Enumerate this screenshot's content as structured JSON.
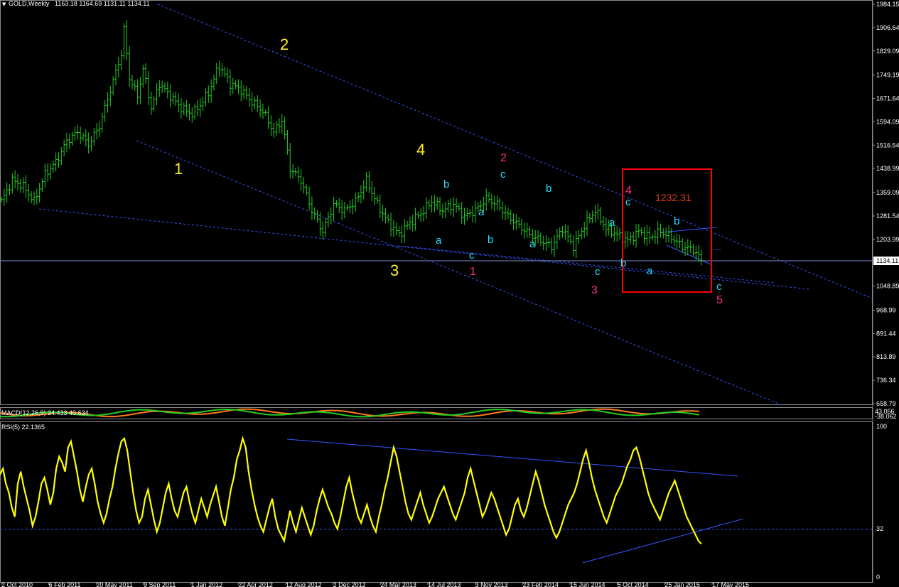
{
  "header": {
    "symbol": "GOLD,Weekly",
    "ohlc": "1163.18 1164.69 1131.11 1134.11",
    "macd_label": "MACD(12,26,9) 24.433 40.634",
    "macd_right_top": "43.056",
    "macd_right_bottom": "-38.062",
    "rsi_label": "RSI(5) 22.1365"
  },
  "price_panel": {
    "current_price_label": "1134.11",
    "box_label": "1232.31"
  },
  "colors": {
    "background": "#000000",
    "bars": "#22cc22",
    "trendlines": "#3355ff",
    "box": "#ff0000",
    "rsi": "#ffff00",
    "wave_yellow": "#ffee22",
    "wave_cyan": "#22e0ff",
    "wave_pink": "#ff2d8a",
    "box_label": "#e03c1e",
    "macd_orange": "#ff7a1a",
    "macd_green": "#22cc22"
  },
  "wave_labels": {
    "yellow": [
      "1",
      "2",
      "3",
      "4"
    ],
    "pink": [
      "1",
      "2",
      "3",
      "4",
      "5"
    ],
    "cyan": [
      "a",
      "b",
      "c",
      "a",
      "b",
      "c",
      "a",
      "b",
      "c",
      "a",
      "b",
      "c",
      "a",
      "b",
      "c"
    ]
  },
  "chart_data": [
    {
      "type": "bar",
      "subtype": "ohlc",
      "title": "GOLD,Weekly",
      "ylim": [
        658.79,
        1984.15
      ],
      "y_ticks": [
        1984.15,
        1906.64,
        1829.09,
        1749.19,
        1671.64,
        1594.09,
        1516.54,
        1438.99,
        1359.09,
        1281.54,
        1203.99,
        1134.11,
        1048.89,
        968.99,
        891.44,
        813.89,
        736.34,
        658.79
      ],
      "x_ticks": [
        "2 Oct 2010",
        "6 Feb 2011",
        "20 May 2011",
        "9 Sep 2011",
        "1 Jan 2012",
        "22 Apr 2012",
        "12 Aug 2012",
        "2 Dec 2012",
        "24 Mar 2013",
        "14 Jul 2013",
        "3 Nov 2013",
        "23 Feb 2014",
        "15 Jun 2014",
        "5 Oct 2014",
        "25 Jan 2015",
        "17 May 2015"
      ],
      "close_path": [
        [
          0,
          1330
        ],
        [
          4,
          1400
        ],
        [
          8,
          1380
        ],
        [
          12,
          1330
        ],
        [
          16,
          1420
        ],
        [
          20,
          1460
        ],
        [
          24,
          1530
        ],
        [
          28,
          1560
        ],
        [
          32,
          1520
        ],
        [
          36,
          1580
        ],
        [
          40,
          1700
        ],
        [
          44,
          1820
        ],
        [
          45,
          1900
        ],
        [
          47,
          1740
        ],
        [
          50,
          1680
        ],
        [
          52,
          1770
        ],
        [
          55,
          1640
        ],
        [
          58,
          1720
        ],
        [
          62,
          1680
        ],
        [
          66,
          1640
        ],
        [
          70,
          1620
        ],
        [
          73,
          1650
        ],
        [
          76,
          1690
        ],
        [
          79,
          1760
        ],
        [
          80,
          1780
        ],
        [
          84,
          1720
        ],
        [
          88,
          1700
        ],
        [
          92,
          1660
        ],
        [
          96,
          1630
        ],
        [
          100,
          1560
        ],
        [
          103,
          1600
        ],
        [
          106,
          1440
        ],
        [
          110,
          1400
        ],
        [
          114,
          1300
        ],
        [
          118,
          1230
        ],
        [
          122,
          1320
        ],
        [
          126,
          1300
        ],
        [
          130,
          1330
        ],
        [
          134,
          1400
        ],
        [
          138,
          1320
        ],
        [
          142,
          1260
        ],
        [
          146,
          1220
        ],
        [
          150,
          1260
        ],
        [
          154,
          1290
        ],
        [
          158,
          1330
        ],
        [
          162,
          1300
        ],
        [
          166,
          1320
        ],
        [
          170,
          1280
        ],
        [
          174,
          1300
        ],
        [
          178,
          1340
        ],
        [
          182,
          1320
        ],
        [
          186,
          1280
        ],
        [
          190,
          1250
        ],
        [
          194,
          1220
        ],
        [
          198,
          1200
        ],
        [
          202,
          1180
        ],
        [
          206,
          1240
        ],
        [
          210,
          1180
        ],
        [
          214,
          1250
        ],
        [
          218,
          1300
        ],
        [
          222,
          1240
        ],
        [
          226,
          1220
        ],
        [
          230,
          1200
        ],
        [
          234,
          1230
        ],
        [
          238,
          1210
        ],
        [
          242,
          1230
        ],
        [
          246,
          1210
        ],
        [
          250,
          1180
        ],
        [
          254,
          1170
        ],
        [
          257,
          1134.11
        ]
      ]
    },
    {
      "type": "line",
      "title": "MACD(12,26,9) 24.433 40.634",
      "series": [
        {
          "name": "MACD",
          "color": "#ff7a1a"
        },
        {
          "name": "Signal",
          "color": "#22cc22"
        }
      ]
    },
    {
      "type": "line",
      "title": "RSI(5) 22.1365",
      "ylim": [
        0,
        100
      ],
      "y_ticks": [
        100,
        32,
        0
      ],
      "levels": [
        32
      ],
      "series": [
        {
          "name": "RSI(5)",
          "values": [
            68,
            72,
            62,
            56,
            46,
            40,
            62,
            70,
            60,
            52,
            44,
            34,
            40,
            50,
            62,
            66,
            58,
            48,
            56,
            72,
            80,
            76,
            70,
            86,
            90,
            80,
            70,
            58,
            50,
            60,
            68,
            72,
            62,
            50,
            42,
            36,
            42,
            52,
            60,
            72,
            82,
            90,
            92,
            84,
            70,
            56,
            44,
            36,
            40,
            52,
            58,
            48,
            38,
            30,
            36,
            46,
            56,
            62,
            52,
            44,
            40,
            48,
            56,
            60,
            50,
            42,
            36,
            44,
            52,
            46,
            40,
            48,
            54,
            60,
            50,
            40,
            34,
            46,
            58,
            66,
            78,
            84,
            92,
            86,
            70,
            58,
            48,
            40,
            34,
            30,
            38,
            46,
            52,
            40,
            32,
            28,
            24,
            34,
            44,
            36,
            30,
            38,
            46,
            40,
            34,
            28,
            34,
            44,
            52,
            58,
            52,
            46,
            42,
            36,
            32,
            40,
            50,
            60,
            66,
            56,
            48,
            40,
            36,
            42,
            48,
            40,
            34,
            30,
            40,
            48,
            58,
            66,
            76,
            86,
            80,
            70,
            60,
            50,
            42,
            38,
            44,
            50,
            56,
            48,
            42,
            36,
            40,
            46,
            52,
            56,
            60,
            54,
            48,
            42,
            38,
            44,
            50,
            56,
            66,
            72,
            64,
            56,
            48,
            40,
            44,
            50,
            56,
            52,
            46,
            40,
            34,
            28,
            32,
            40,
            48,
            52,
            44,
            40,
            46,
            54,
            62,
            70,
            64,
            56,
            48,
            42,
            36,
            30,
            26,
            30,
            36,
            42,
            48,
            52,
            56,
            62,
            70,
            78,
            84,
            76,
            66,
            58,
            52,
            46,
            40,
            36,
            42,
            48,
            54,
            58,
            62,
            68,
            74,
            78,
            84,
            86,
            80,
            72,
            64,
            56,
            50,
            46,
            42,
            38,
            44,
            50,
            56,
            60,
            64,
            58,
            52,
            46,
            40,
            36,
            32,
            28,
            24,
            22
          ]
        }
      ]
    }
  ]
}
